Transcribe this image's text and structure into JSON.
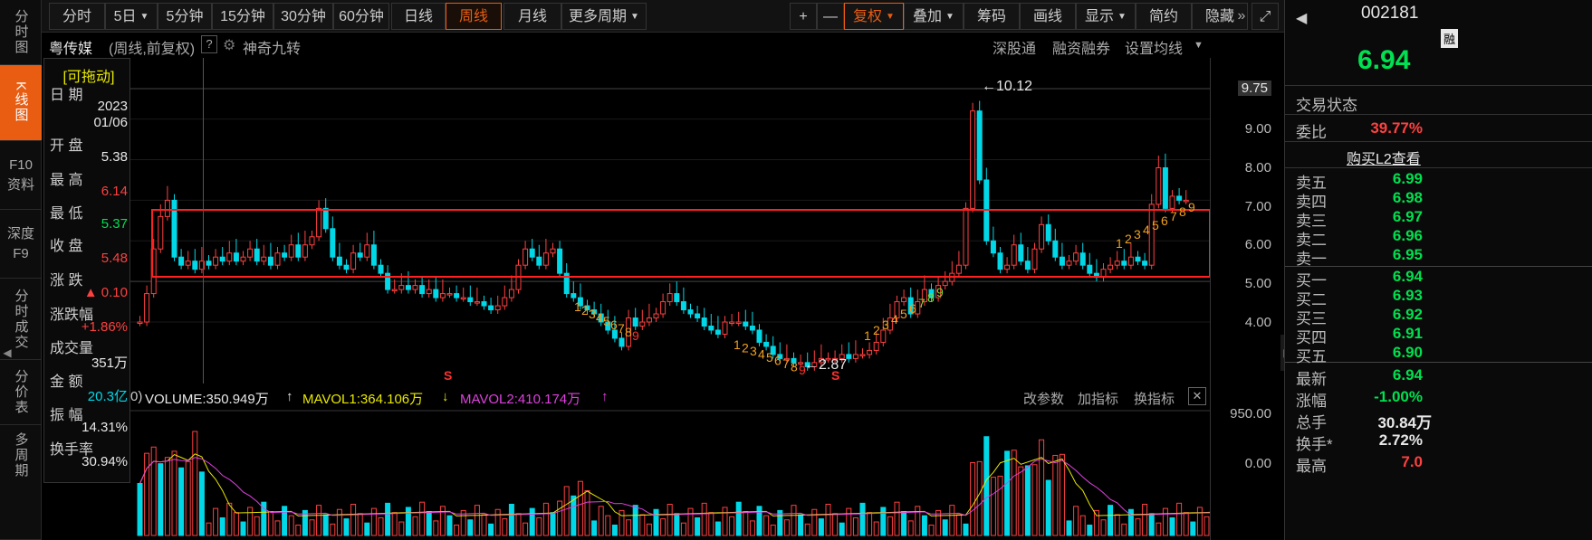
{
  "left_nav": [
    {
      "label": "分时图"
    },
    {
      "label": "K线图",
      "active": true
    },
    {
      "label": "F10资料"
    },
    {
      "label": "深度F9"
    },
    {
      "label": "分时成交"
    },
    {
      "label": "分价表"
    },
    {
      "label": "多周期"
    }
  ],
  "toolbar": {
    "periods": [
      "分时",
      "5日",
      "5分钟",
      "15分钟",
      "30分钟",
      "60分钟",
      "日线",
      "周线",
      "月线"
    ],
    "more_periods": "更多周期",
    "active_period": "周线",
    "plus": "+",
    "minus": "—",
    "restore_rights": "复权",
    "overlay": "叠加",
    "chips": "筹码",
    "draw_line": "画线",
    "display": "显示",
    "simple": "简约",
    "hide": "隐藏",
    "more_arrow": "»",
    "fullscreen_icon": "expand-icon"
  },
  "subheader": {
    "stock_name": "粤传媒",
    "mode": "(周线,前复权)",
    "help": "?",
    "indicator": "神奇九转",
    "links": [
      "深股通",
      "融资融券",
      "设置均线"
    ]
  },
  "info_panel": {
    "draggable": "[可拖动]",
    "date_label": "日 期",
    "date_year": "2023",
    "date_md": "01/06",
    "open_label": "开 盘",
    "open": "5.38",
    "high_label": "最 高",
    "high": "6.14",
    "low_label": "最 低",
    "low": "5.37",
    "close_label": "收 盘",
    "close": "5.48",
    "change_label": "涨 跌",
    "change": "▲ 0.10",
    "change_pct_label": "涨跌幅",
    "change_pct": "+1.86%",
    "volume_label": "成交量",
    "volume": "351万",
    "amount_label": "金 额",
    "amount": "20.3亿",
    "amplitude_label": "振 幅",
    "amplitude": "14.31%",
    "turnover_label": "换手率",
    "turnover": "30.94%"
  },
  "chart": {
    "price_axis": [
      "9.75",
      "9.00",
      "8.00",
      "7.00",
      "6.00",
      "5.00",
      "4.00"
    ],
    "max_label": "10.12",
    "min_label": "2.87",
    "nine_turn_marks": [
      "1",
      "2",
      "3",
      "4",
      "5",
      "6",
      "7",
      "8",
      "9",
      "1",
      "2",
      "3",
      "4",
      "5",
      "6",
      "7",
      "8",
      "9",
      "1",
      "2",
      "3",
      "4",
      "5",
      "6",
      "7",
      "8",
      "9",
      "1",
      "2",
      "3",
      "4",
      "5",
      "6",
      "7",
      "8",
      "9"
    ],
    "s_mark": "S"
  },
  "volume": {
    "prefix": "0)",
    "volume_label": "VOLUME:350.949万",
    "volume_arrow": "↑",
    "mavol1_label": "MAVOL1:364.106万",
    "mavol1_arrow": "↓",
    "mavol2_label": "MAVOL2:410.174万",
    "mavol2_arrow": "↑",
    "change_params": "改参数",
    "add_indicator": "加指标",
    "switch_indicator": "换指标",
    "close_icon": "close-icon",
    "axis_top": "950.00",
    "axis_bottom": "0.00"
  },
  "right_panel": {
    "code": "002181",
    "badge": "融",
    "price": "6.94",
    "trade_status": "交易状态",
    "wei_bi_label": "委比",
    "wei_bi": "39.77%",
    "buy_l2": "购买L2查看",
    "asks": [
      {
        "label": "卖五",
        "price": "6.99"
      },
      {
        "label": "卖四",
        "price": "6.98"
      },
      {
        "label": "卖三",
        "price": "6.97"
      },
      {
        "label": "卖二",
        "price": "6.96"
      },
      {
        "label": "卖一",
        "price": "6.95"
      }
    ],
    "bids": [
      {
        "label": "买一",
        "price": "6.94"
      },
      {
        "label": "买二",
        "price": "6.93"
      },
      {
        "label": "买三",
        "price": "6.92"
      },
      {
        "label": "买四",
        "price": "6.91"
      },
      {
        "label": "买五",
        "price": "6.90"
      }
    ],
    "latest_label": "最新",
    "latest": "6.94",
    "change_pct_label": "涨幅",
    "change_pct": "-1.00%",
    "total_hands_label": "总手",
    "total_hands": "30.84万",
    "turnover_label": "换手*",
    "turnover": "2.72%",
    "high_label": "最高",
    "high": "7.0"
  },
  "colors": {
    "up": "#ff4040",
    "down": "#00d8e8",
    "accent": "#e85d12",
    "box": "#ff2020",
    "mavol1": "#e8e800",
    "mavol2": "#e040e0"
  }
}
